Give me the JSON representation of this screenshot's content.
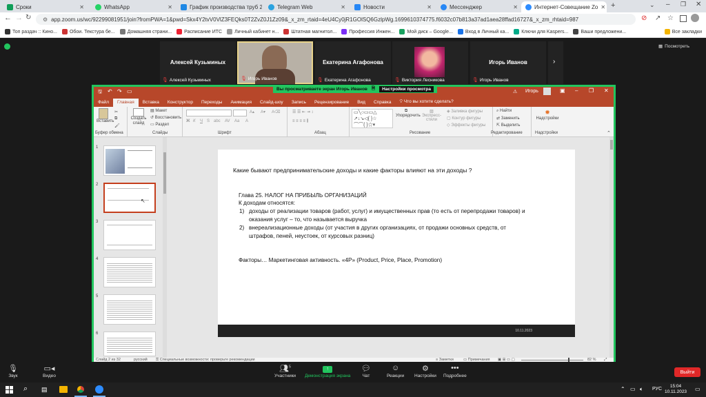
{
  "browser": {
    "tabs": [
      {
        "label": "Сроки",
        "color": "#0f9d58"
      },
      {
        "label": "WhatsApp",
        "color": "#25d366"
      },
      {
        "label": "График производства труб 20",
        "color": "#0f9d58"
      },
      {
        "label": "Telegram Web",
        "color": "#2aa3e0"
      },
      {
        "label": "Новости",
        "color": "#2787f5"
      },
      {
        "label": "Мессенджер",
        "color": "#2787f5"
      },
      {
        "label": "Интернет-Совещание Zo",
        "color": "#2d8cff"
      }
    ],
    "url": "app.zoom.us/wc/92299081951/join?fromPWA=1&pwd=Skx4Y2tvV0VlZ3FEQks0T2ZvZ0J1Zz09&_x_zm_rtaid=4eU4Cy0jR1GOlSQ6GzlpWg.1699610374775.f6032c07b813a37ad1aea28ffad16727&_x_zm_rhtaid=987",
    "bookmarks": [
      {
        "label": "Топ раздач :: Кино...",
        "color": "#333"
      },
      {
        "label": "Обои. Текстура бе...",
        "color": "#c33"
      },
      {
        "label": "Домашняя страни...",
        "color": "#777"
      },
      {
        "label": "Расписание ИТС",
        "color": "#e23"
      },
      {
        "label": "Личный кабинет н...",
        "color": "#999"
      },
      {
        "label": "Штатная магнитол...",
        "color": "#c33"
      },
      {
        "label": "Профессия Инжен...",
        "color": "#7b2ff7"
      },
      {
        "label": "Мой диск – Google...",
        "color": "#1aa260"
      },
      {
        "label": "Вход в Личный ка...",
        "color": "#1a73e8"
      },
      {
        "label": "Ключи для Kaspers...",
        "color": "#0a8"
      },
      {
        "label": "Ваши предложени...",
        "color": "#444"
      }
    ],
    "all_bookmarks": "Все закладки"
  },
  "zoom": {
    "view_label": "Посмотреть",
    "videos": [
      {
        "big": "Алексей Кузьминых",
        "label": "Алексей Кузьминых"
      },
      {
        "big": "",
        "label": "Игорь Иванов"
      },
      {
        "big": "Екатерина Агафонова",
        "label": "Екатерина Агафонова"
      },
      {
        "big": "",
        "label": "Виктория Лесникова"
      },
      {
        "big": "Игорь Иванов",
        "label": "Игорь Иванов"
      }
    ],
    "banner": "Вы просматриваете экран Игорь Иванов",
    "view_settings": "Настройки просмотра",
    "toolbar": {
      "audio": "Звук",
      "video": "Видео",
      "participants": "Участники",
      "participants_count": "5",
      "share": "Демонстрация экрана",
      "chat": "Чат",
      "reactions": "Реакции",
      "settings": "Настройки",
      "more": "Подробнее",
      "leave": "Выйти"
    }
  },
  "ppt": {
    "user": "Игорь",
    "menu": [
      "Файл",
      "Главная",
      "Вставка",
      "Конструктор",
      "Переходы",
      "Анимация",
      "Слайд-шоу",
      "Запись",
      "Рецензирование",
      "Вид",
      "Справка",
      "Что вы хотите сделать?"
    ],
    "ribbon": {
      "paste": "Вставить",
      "clipboard": "Буфер обмена",
      "new_slide": "Создать слайд",
      "layout": "Макет",
      "reset": "Восстановить",
      "section": "Раздел",
      "slides": "Слайды",
      "font": "Шрифт",
      "paragraph": "Абзац",
      "arrange": "Упорядочить",
      "quick_styles": "Экспресс-стили",
      "fill": "Заливка фигуры",
      "outline": "Контур фигуры",
      "effects": "Эффекты фигуры",
      "drawing": "Рисование",
      "find": "Найти",
      "replace": "Заменить",
      "select": "Выделить",
      "editing": "Редактирование",
      "addins": "Надстройки",
      "addins_group": "Надстройки"
    },
    "slide": {
      "question": "Какие бывают предпринимательские доходы и какие факторы влияют на эти доходы ?",
      "chapter": "Глава 25. НАЛОГ НА ПРИБЫЛЬ ОРГАНИЗАЦИЙ",
      "intro": "К доходам относятся:",
      "item1_num": "1)",
      "item1_line1": "доходы от реализации товаров (работ, услуг) и имущественных прав (то есть от перепродажи товаров) и",
      "item1_line2": "оказания услуг – то, что называется выручка",
      "item2_num": "2)",
      "item2_line1": "внереализационные доходы (от участия в других организациях, от продажи основных средств, от",
      "item2_line2": "штрафов, пеней, неустоек, от курсовых разниц)",
      "factors": "Факторы… Маркетинговая активность. «4P» (Product, Price, Place, Promotion)",
      "date": "10.11.2023"
    },
    "thumb_numbers": [
      "1",
      "2",
      "3",
      "4",
      "5",
      "6"
    ],
    "status": {
      "slide": "Слайд 2 из 32",
      "lang": "русский",
      "access": "Специальные возможности: проверьте рекомендации",
      "notes": "Заметки",
      "comments": "Примечания",
      "zoom": "82 %"
    }
  },
  "taskbar": {
    "lang": "РУС",
    "time": "15:04",
    "date": "10.11.2023"
  },
  "colors": {
    "accent_green": "#22c55e",
    "ppt_red": "#b7472a",
    "leave_red": "#e02828"
  }
}
